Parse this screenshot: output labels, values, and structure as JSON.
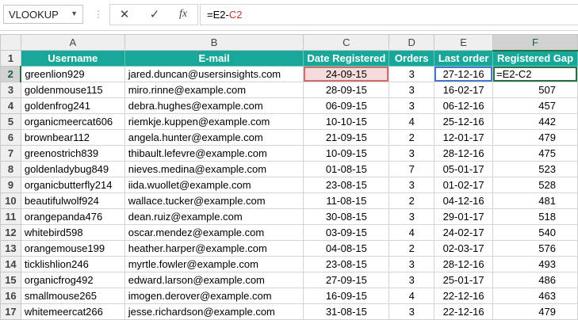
{
  "name_box": {
    "value": "VLOOKUP",
    "dropdown_icon": "caret-down"
  },
  "formula_bar": {
    "cancel_icon": "close-icon",
    "enter_icon": "check-icon",
    "insert_function_label": "fx",
    "formula_prefix": "=E2-",
    "formula_ref": "C2",
    "ref_color": "#c0392b"
  },
  "columns": [
    "A",
    "B",
    "C",
    "D",
    "E",
    "F"
  ],
  "selected_column": "F",
  "selected_row": 2,
  "header_row": {
    "row_number": "1",
    "cells": [
      "Username",
      "E-mail",
      "Date Registered",
      "Orders",
      "Last order",
      "Registered Gap"
    ]
  },
  "rows": [
    {
      "n": "2",
      "username": "greenlion929",
      "email": "jared.duncan@usersinsights.com",
      "date_registered": "24-09-15",
      "orders": "3",
      "last_order": "27-12-16",
      "gap": "",
      "gap_prefix": "=E2-",
      "gap_ref": "C2"
    },
    {
      "n": "3",
      "username": "goldenmouse115",
      "email": "miro.rinne@example.com",
      "date_registered": "28-09-15",
      "orders": "3",
      "last_order": "16-02-17",
      "gap": "507"
    },
    {
      "n": "4",
      "username": "goldenfrog241",
      "email": "debra.hughes@example.com",
      "date_registered": "06-09-15",
      "orders": "3",
      "last_order": "06-12-16",
      "gap": "457"
    },
    {
      "n": "5",
      "username": "organicmeercat606",
      "email": "riemkje.kuppen@example.com",
      "date_registered": "10-10-15",
      "orders": "4",
      "last_order": "25-12-16",
      "gap": "442"
    },
    {
      "n": "6",
      "username": "brownbear112",
      "email": "angela.hunter@example.com",
      "date_registered": "21-09-15",
      "orders": "2",
      "last_order": "12-01-17",
      "gap": "479"
    },
    {
      "n": "7",
      "username": "greenostrich839",
      "email": "thibault.lefevre@example.com",
      "date_registered": "10-09-15",
      "orders": "3",
      "last_order": "28-12-16",
      "gap": "475"
    },
    {
      "n": "8",
      "username": "goldenladybug849",
      "email": "nieves.medina@example.com",
      "date_registered": "01-08-15",
      "orders": "7",
      "last_order": "05-01-17",
      "gap": "523"
    },
    {
      "n": "9",
      "username": "organicbutterfly214",
      "email": "iida.wuollet@example.com",
      "date_registered": "23-08-15",
      "orders": "3",
      "last_order": "01-02-17",
      "gap": "528"
    },
    {
      "n": "10",
      "username": "beautifulwolf924",
      "email": "wallace.tucker@example.com",
      "date_registered": "11-08-15",
      "orders": "2",
      "last_order": "04-12-16",
      "gap": "481"
    },
    {
      "n": "11",
      "username": "orangepanda476",
      "email": "dean.ruiz@example.com",
      "date_registered": "30-08-15",
      "orders": "3",
      "last_order": "29-01-17",
      "gap": "518"
    },
    {
      "n": "12",
      "username": "whitebird598",
      "email": "oscar.mendez@example.com",
      "date_registered": "03-09-15",
      "orders": "4",
      "last_order": "24-02-17",
      "gap": "540"
    },
    {
      "n": "13",
      "username": "orangemouse199",
      "email": "heather.harper@example.com",
      "date_registered": "04-08-15",
      "orders": "2",
      "last_order": "02-03-17",
      "gap": "576"
    },
    {
      "n": "14",
      "username": "ticklishlion246",
      "email": "myrtle.fowler@example.com",
      "date_registered": "23-08-15",
      "orders": "3",
      "last_order": "28-12-16",
      "gap": "493"
    },
    {
      "n": "15",
      "username": "organicfrog492",
      "email": "edward.larson@example.com",
      "date_registered": "27-09-15",
      "orders": "3",
      "last_order": "25-01-17",
      "gap": "486"
    },
    {
      "n": "16",
      "username": "smallmouse265",
      "email": "imogen.derover@example.com",
      "date_registered": "16-09-15",
      "orders": "4",
      "last_order": "22-12-16",
      "gap": "463"
    },
    {
      "n": "17",
      "username": "whitemeercat266",
      "email": "jesse.richardson@example.com",
      "date_registered": "31-08-15",
      "orders": "3",
      "last_order": "22-12-16",
      "gap": "479"
    }
  ],
  "colors": {
    "header_fill": "#19a79a",
    "header_text": "#ffffff",
    "selection_green": "#217346",
    "ref_red": "#c0392b",
    "ref_blue": "#1f4e9c"
  }
}
